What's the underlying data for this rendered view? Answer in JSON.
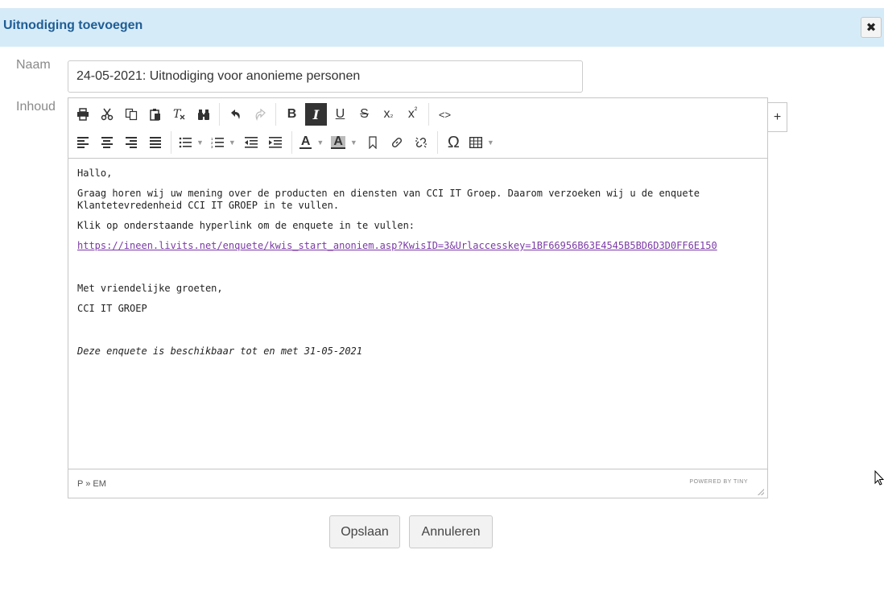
{
  "dialog": {
    "title": "Uitnodiging toevoegen",
    "close_label": "✖"
  },
  "form": {
    "naam_label": "Naam",
    "naam_value": "24-05-2021: Uitnodiging voor anonieme personen",
    "inhoud_label": "Inhoud",
    "plus_label": "+"
  },
  "editor": {
    "toolbar_row1": {
      "bold": "B",
      "italic": "I",
      "underline": "U",
      "strike": "S",
      "subscript": "x",
      "subscript_mark": "₂",
      "superscript": "x",
      "superscript_mark": "²",
      "code": "<>"
    },
    "toolbar_row2": {
      "font_color": "A",
      "highlight_color": "A",
      "special_char": "Ω"
    },
    "content": {
      "greeting": "Hallo,",
      "paragraph1": "Graag horen wij uw mening over de producten en diensten van CCI IT Groep. Daarom verzoeken wij u de enquete Klantetevredenheid CCI IT GROEP in te vullen.",
      "paragraph2": "Klik op onderstaande hyperlink om de enquete in te vullen:",
      "link": "https://ineen.livits.net/enquete/kwis_start_anoniem.asp?KwisID=3&Urlaccesskey=1BF66956B63E4545B5BD6D3D0FF6E150",
      "closing": "Met vriendelijke groeten,",
      "signature": "CCI IT GROEP",
      "note": "Deze enquete is beschikbaar tot en met 31-05-2021"
    },
    "status_path": "P » EM",
    "powered_by": "POWERED BY TINY"
  },
  "buttons": {
    "save": "Opslaan",
    "cancel": "Annuleren"
  }
}
